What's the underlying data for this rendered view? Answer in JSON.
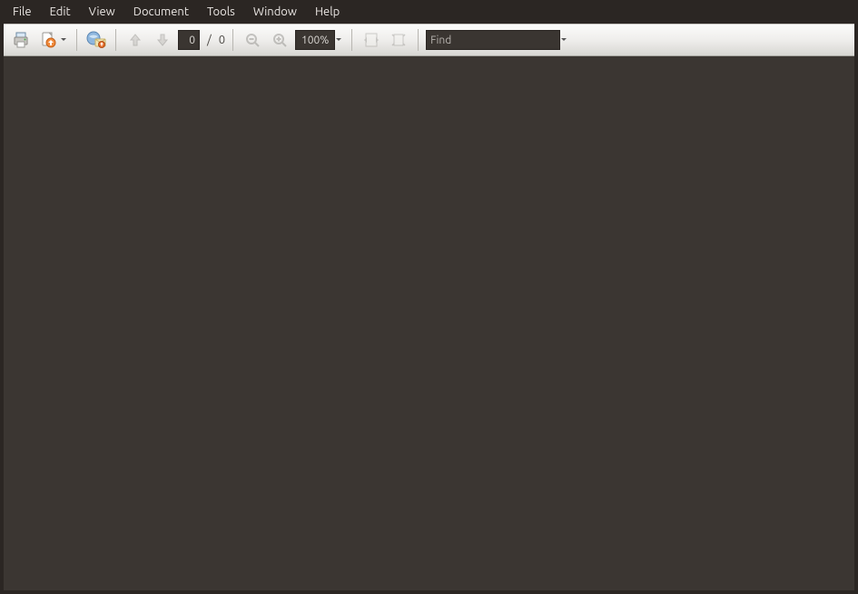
{
  "menu": {
    "items": [
      "File",
      "Edit",
      "View",
      "Document",
      "Tools",
      "Window",
      "Help"
    ]
  },
  "toolbar": {
    "page_current": "0",
    "page_total": "0",
    "zoom_value": "100%",
    "find_placeholder": "Find"
  },
  "icons": {
    "print": "print-icon",
    "open": "open-file-icon",
    "email": "send-email-icon",
    "prev_page": "arrow-up-icon",
    "next_page": "arrow-down-icon",
    "zoom_out": "zoom-out-icon",
    "zoom_in": "zoom-in-icon",
    "fit_width": "fit-width-icon",
    "fit_page": "fit-page-icon"
  },
  "colors": {
    "menu_bg": "#2b2623",
    "menu_fg": "#e9e5e2",
    "toolbar_light": "#fbfbfa",
    "toolbar_dark": "#d8d7d3",
    "viewer_bg": "#3b3632",
    "field_bg": "#3a3531",
    "accent_orange": "#e76f2e"
  }
}
